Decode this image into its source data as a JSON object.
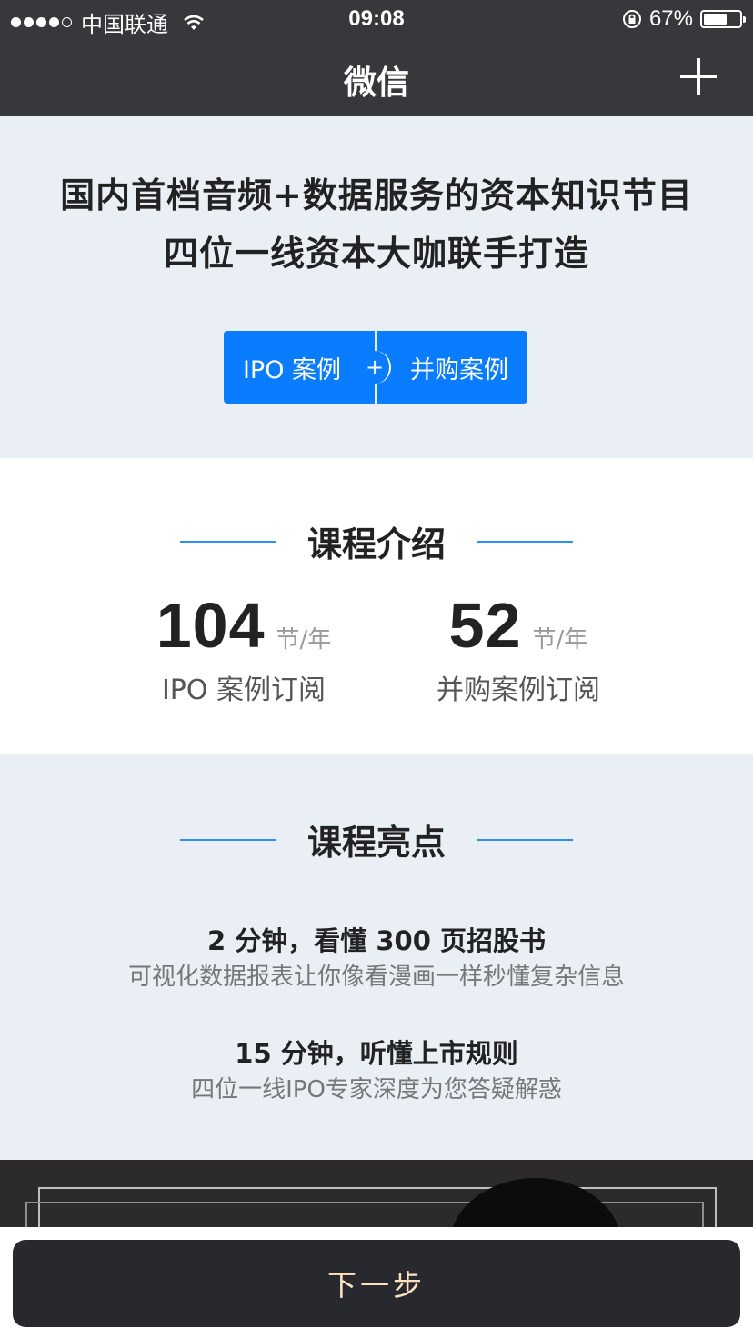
{
  "status_bar": {
    "carrier": "中国联通",
    "time": "09:08",
    "battery": "67%",
    "battery_level": 0.67,
    "signal_icon": "signal-dots-icon",
    "wifi_icon": "wifi-icon",
    "lock_icon": "orientation-lock-icon"
  },
  "nav": {
    "title": "微信",
    "plus_icon": "plus-icon"
  },
  "hero": {
    "line1": "国内首档音频+数据服务的资本知识节目",
    "line2": "四位一线资本大咖联手打造",
    "btn_ipo": "IPO 案例",
    "btn_plus": "+",
    "btn_ma": "并购案例"
  },
  "intro": {
    "heading": "课程介绍",
    "stats": [
      {
        "num": "104",
        "unit": "节/年",
        "label": "IPO 案例订阅"
      },
      {
        "num": "52",
        "unit": "节/年",
        "label": "并购案例订阅"
      }
    ]
  },
  "highlights": {
    "heading": "课程亮点",
    "items": [
      {
        "title": "2 分钟，看懂 300 页招股书",
        "sub": "可视化数据报表让你像看漫画一样秒懂复杂信息"
      },
      {
        "title": "15 分钟，听懂上市规则",
        "sub": "四位一线IPO专家深度为您答疑解惑"
      }
    ]
  },
  "footer": {
    "next_label": "下一步"
  },
  "colors": {
    "accent": "#0a7cff",
    "dark": "#38383c",
    "button_text": "#ffe1bf"
  }
}
